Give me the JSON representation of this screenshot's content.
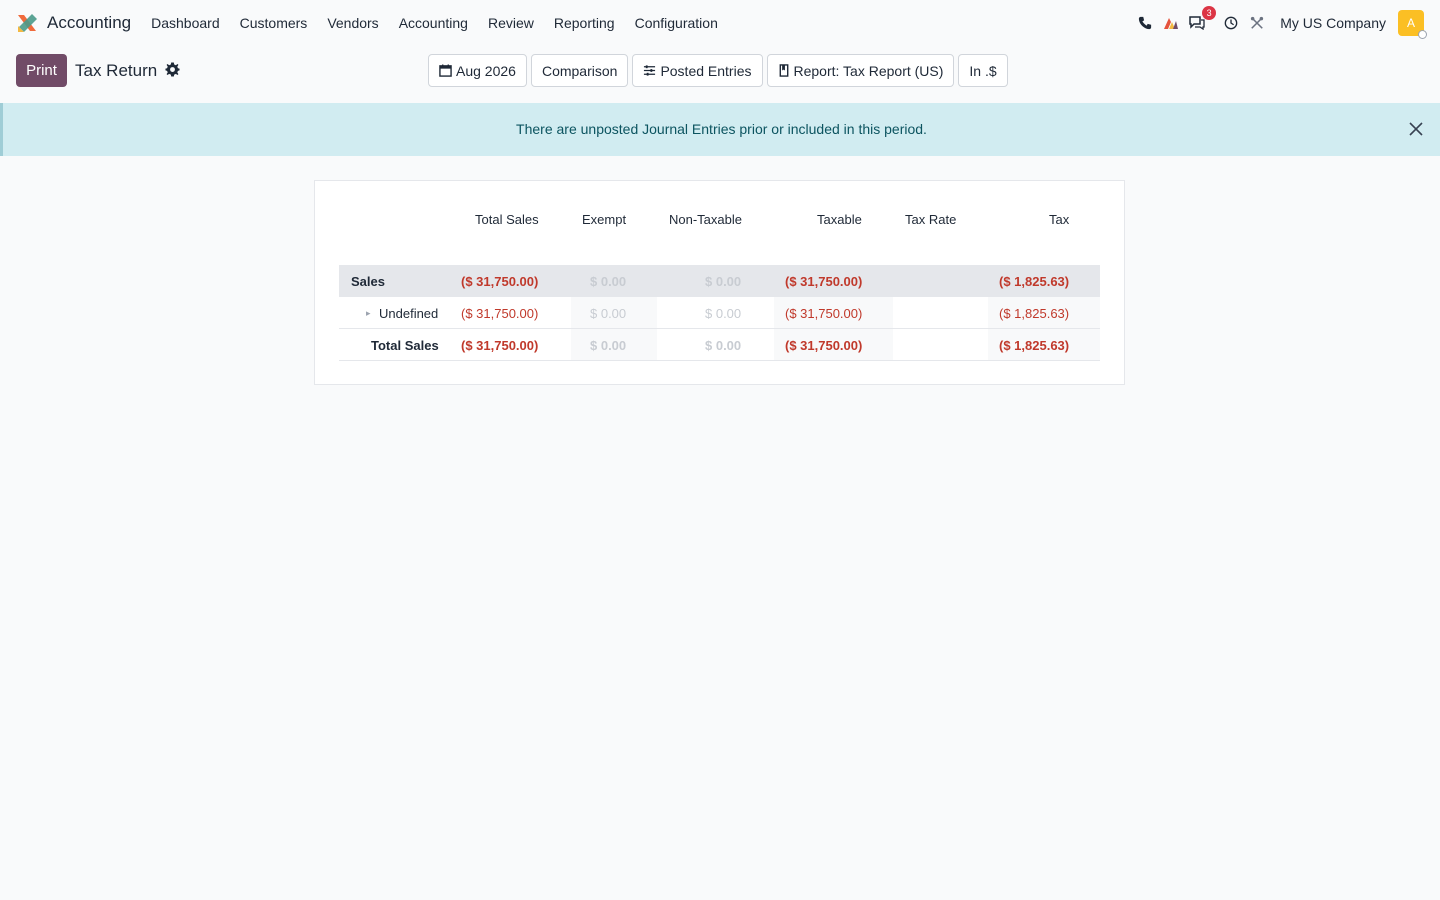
{
  "navbar": {
    "app_name": "Accounting",
    "menu": [
      "Dashboard",
      "Customers",
      "Vendors",
      "Accounting",
      "Review",
      "Reporting",
      "Configuration"
    ],
    "messages_badge": "3",
    "company": "My US Company",
    "avatar_initial": "A",
    "icons": [
      "phone-icon",
      "brand-icon",
      "messages-icon",
      "clock-icon",
      "tools-icon"
    ]
  },
  "control": {
    "print_label": "Print",
    "report_title": "Tax Return",
    "filters": {
      "date": "Aug 2026",
      "comparison": "Comparison",
      "posted": "Posted Entries",
      "report": "Report: Tax Report (US)",
      "currency": "In .$"
    }
  },
  "alert": {
    "message": "There are unposted Journal Entries prior or included in this period."
  },
  "table": {
    "headers": {
      "total_sales": "Total Sales",
      "exempt": "Exempt",
      "non_taxable": "Non-Taxable",
      "taxable": "Taxable",
      "tax_rate": "Tax Rate",
      "tax": "Tax"
    },
    "rows": [
      {
        "label": "Sales",
        "total_sales": "($ 31,750.00)",
        "exempt": "$ 0.00",
        "non_taxable": "$ 0.00",
        "taxable": "($ 31,750.00)",
        "tax_rate": "",
        "tax": "($ 1,825.63)"
      },
      {
        "label": "Undefined",
        "total_sales": "($ 31,750.00)",
        "exempt": "$ 0.00",
        "non_taxable": "$ 0.00",
        "taxable": "($ 31,750.00)",
        "tax_rate": "",
        "tax": "($ 1,825.63)"
      },
      {
        "label": "Total Sales",
        "total_sales": "($ 31,750.00)",
        "exempt": "$ 0.00",
        "non_taxable": "$ 0.00",
        "taxable": "($ 31,750.00)",
        "tax_rate": "",
        "tax": "($ 1,825.63)"
      }
    ]
  },
  "colors": {
    "brand": "#714b67",
    "negative": "#c0392b",
    "alert_bg": "#d1ecf1",
    "alert_text": "#0c5460"
  }
}
